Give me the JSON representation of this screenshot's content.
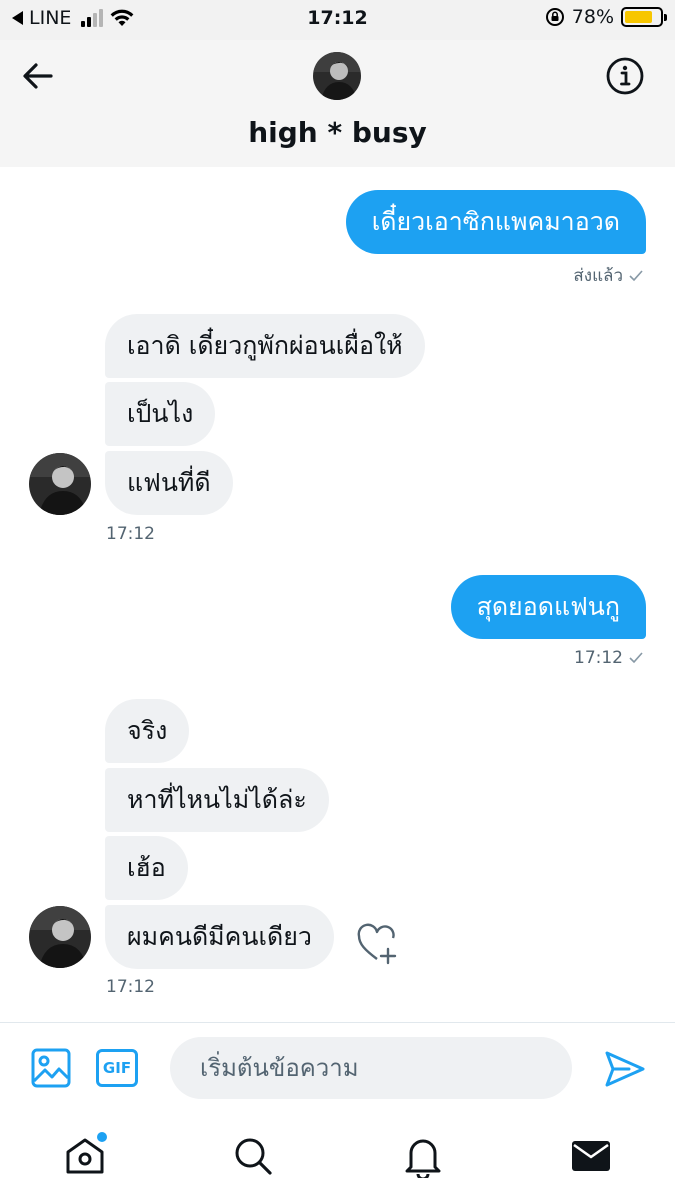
{
  "status_bar": {
    "carrier": "LINE",
    "time": "17:12",
    "battery": "78%",
    "battery_level": 0.78,
    "icons": [
      "back-triangle-icon",
      "signal-icon",
      "wifi-icon",
      "orientation-lock-icon",
      "battery-icon"
    ]
  },
  "header": {
    "title": "high * busy",
    "icons": [
      "back-arrow-icon",
      "info-icon"
    ]
  },
  "messages": [
    {
      "direction": "sent",
      "text": "เดี๋ยวเอาซิกแพคมาอวด"
    },
    {
      "direction": "sent_meta",
      "text": "ส่งแล้ว"
    },
    {
      "direction": "received",
      "text": "เอาดิ เดี๋ยวกูพักผ่อนเผื่อให้"
    },
    {
      "direction": "received",
      "text": "เป็นไง"
    },
    {
      "direction": "received",
      "text": "แฟนที่ดี"
    },
    {
      "direction": "received_meta",
      "text": "17:12"
    },
    {
      "direction": "sent",
      "text": "สุดยอดแฟนกู"
    },
    {
      "direction": "sent_meta",
      "text": "17:12"
    },
    {
      "direction": "received",
      "text": "จริง"
    },
    {
      "direction": "received",
      "text": "หาที่ไหนไม่ได้ล่ะ"
    },
    {
      "direction": "received",
      "text": "เฮ้อ"
    },
    {
      "direction": "received",
      "text": "ผมคนดีมีคนเดียว"
    },
    {
      "direction": "received_meta",
      "text": "17:12"
    }
  ],
  "composer": {
    "placeholder": "เริ่มต้นข้อความ",
    "gif_label": "GIF",
    "icons": [
      "image-icon",
      "gif-icon",
      "send-icon"
    ]
  },
  "bottom_nav": {
    "items": [
      "home-icon",
      "search-icon",
      "notifications-icon",
      "messages-icon"
    ]
  },
  "colors": {
    "accent": "#1da1f2",
    "received_bubble": "#eff1f3",
    "battery": "#f7c600"
  }
}
